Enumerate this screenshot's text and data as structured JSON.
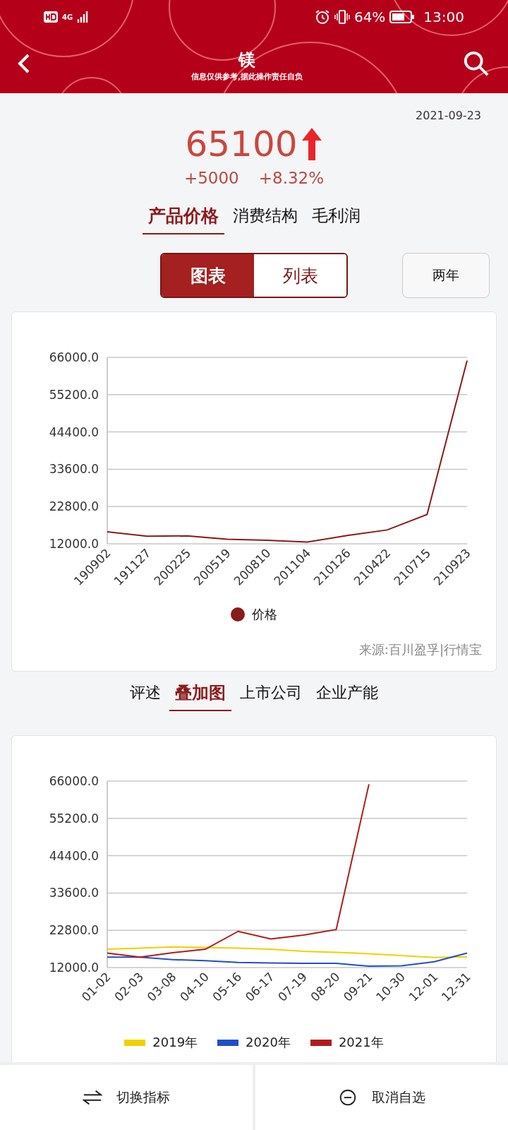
{
  "status_bar": {
    "network": "4G",
    "battery": "64%",
    "time": "13:00"
  },
  "header": {
    "title": "镁",
    "subtitle": "信息仅供参考,据此操作责任自负"
  },
  "quote": {
    "date": "2021-09-23",
    "price": "65100",
    "rising": true,
    "change": "+5000",
    "change_pct": "+8.32%"
  },
  "tabs": [
    {
      "label": "产品价格",
      "selected": true
    },
    {
      "label": "消费结构",
      "selected": false
    },
    {
      "label": "毛利润",
      "selected": false
    }
  ],
  "view_toggle": [
    {
      "label": "图表",
      "selected": true
    },
    {
      "label": "列表",
      "selected": false
    }
  ],
  "range_button": "两年",
  "price_chart": {
    "chart_data": {
      "type": "line",
      "grid": true,
      "legend": "bottom",
      "yticks": [
        {
          "value": 12000,
          "label": "12000.0"
        },
        {
          "value": 22800,
          "label": "22800.0"
        },
        {
          "value": 33600,
          "label": "33600.0"
        },
        {
          "value": 44400,
          "label": "44400.0"
        },
        {
          "value": 55200,
          "label": "55200.0"
        },
        {
          "value": 66000,
          "label": "66000.0"
        }
      ],
      "ylim": [
        12000,
        66000
      ],
      "categories": [
        "190902",
        "191127",
        "200225",
        "200519",
        "200810",
        "201104",
        "210126",
        "210422",
        "210715",
        "210923"
      ],
      "series": [
        {
          "name": "价格",
          "color": "#8b1a1a",
          "values": [
            15500,
            14200,
            14300,
            13300,
            13000,
            12500,
            14400,
            16000,
            20500,
            65100
          ]
        }
      ]
    },
    "source": "来源:百川盈孚|行情宝"
  },
  "sub_tabs": [
    {
      "label": "评述",
      "selected": false
    },
    {
      "label": "叠加图",
      "selected": true
    },
    {
      "label": "上市公司",
      "selected": false
    },
    {
      "label": "企业产能",
      "selected": false
    }
  ],
  "overlay_chart": {
    "chart_data": {
      "type": "line",
      "grid": true,
      "legend": "bottom",
      "yticks": [
        {
          "value": 12000,
          "label": "12000.0"
        },
        {
          "value": 22800,
          "label": "22800.0"
        },
        {
          "value": 33600,
          "label": "33600.0"
        },
        {
          "value": 44400,
          "label": "44400.0"
        },
        {
          "value": 55200,
          "label": "55200.0"
        },
        {
          "value": 66000,
          "label": "66000.0"
        }
      ],
      "ylim": [
        12000,
        66000
      ],
      "categories": [
        "01-02",
        "02-03",
        "03-08",
        "04-10",
        "05-16",
        "06-17",
        "07-19",
        "08-20",
        "09-21",
        "10-30",
        "12-01",
        "12-31"
      ],
      "series": [
        {
          "name": "2019年",
          "color": "#f0d000",
          "values": [
            17300,
            17600,
            18000,
            17800,
            17600,
            17300,
            16700,
            16400,
            16000,
            15500,
            14900,
            15100
          ]
        },
        {
          "name": "2020年",
          "color": "#1f4fc8",
          "values": [
            15000,
            15000,
            14300,
            14000,
            13500,
            13300,
            13200,
            13200,
            12400,
            12500,
            13700,
            16200
          ]
        },
        {
          "name": "2021年",
          "color": "#b01c1c",
          "values": [
            16200,
            15000,
            16300,
            17300,
            22500,
            20300,
            21400,
            23000,
            65100,
            null,
            null,
            null
          ]
        }
      ]
    }
  },
  "bottom_actions": [
    {
      "label": "切换指标",
      "kind": "swap"
    },
    {
      "label": "取消自选",
      "kind": "remove"
    }
  ]
}
